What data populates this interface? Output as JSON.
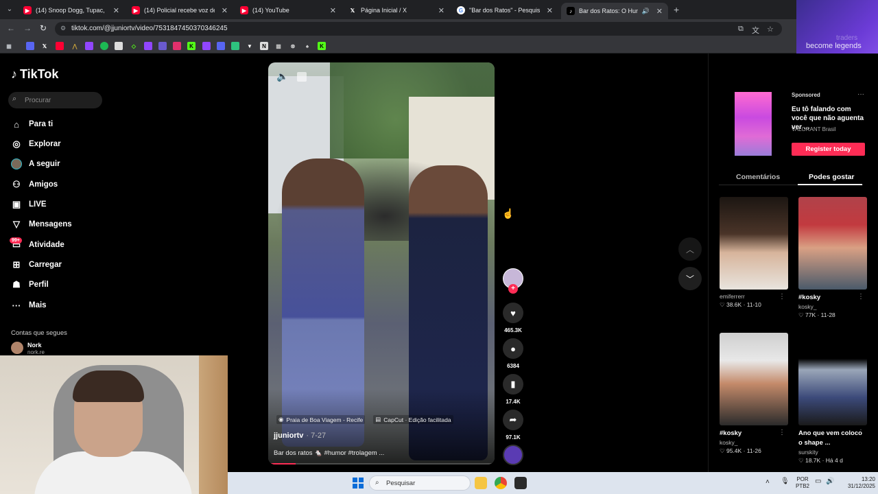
{
  "browser": {
    "tabs": [
      {
        "title": "(14) Snoop Dogg, Tupac, Nate ",
        "icon": "youtube-icon",
        "active": false
      },
      {
        "title": "(14) Policial recebe voz de prisã",
        "icon": "youtube-icon",
        "active": false
      },
      {
        "title": "(14) YouTube",
        "icon": "youtube-icon",
        "active": false
      },
      {
        "title": "Página Inicial / X",
        "icon": "x-icon",
        "active": false
      },
      {
        "title": "\"Bar dos Ratos\" - Pesquisa Goog",
        "icon": "google-icon",
        "active": false
      },
      {
        "title": "Bar dos Ratos: O Humor qu",
        "icon": "tiktok-icon",
        "active": true
      }
    ],
    "url": "tiktok.com/@jjuniortv/video/7531847450370346245"
  },
  "overlay_ad": {
    "line1": "traders",
    "line2": "become legends",
    "brand": "fomo"
  },
  "sidebar": {
    "logo": "TikTok",
    "search_placeholder": "Procurar",
    "items": [
      {
        "label": "Para ti",
        "icon": "home-icon"
      },
      {
        "label": "Explorar",
        "icon": "compass-icon"
      },
      {
        "label": "A seguir",
        "icon": "following-avatar-icon"
      },
      {
        "label": "Amigos",
        "icon": "friends-icon"
      },
      {
        "label": "LIVE",
        "icon": "live-icon"
      },
      {
        "label": "Mensagens",
        "icon": "messages-icon"
      },
      {
        "label": "Atividade",
        "icon": "activity-icon"
      },
      {
        "label": "Carregar",
        "icon": "upload-icon"
      },
      {
        "label": "Perfil",
        "icon": "profile-icon"
      },
      {
        "label": "Mais",
        "icon": "more-icon"
      }
    ],
    "activity_badge": "99+",
    "following_title": "Contas que segues",
    "following_user": {
      "name": "Nork",
      "handle": "nork.re"
    }
  },
  "video": {
    "location": "Praia de Boa Viagem - Recife",
    "app_tag": "CapCut · Edição facilitada",
    "author": "jjuniortv",
    "date": "· 7-27",
    "caption": "Bar dos ratos 🐁 #humor #trolagem ...",
    "progress_fraction": 0.12
  },
  "actions": {
    "likes": "465.3K",
    "comments": "6384",
    "saves": "17.4K",
    "shares": "97.1K"
  },
  "right_panel": {
    "ad": {
      "sponsored": "Sponsored",
      "title": "Eu tô falando com você que não aguenta ver ...",
      "brand": "VALORANT Brasil",
      "cta": "Register today"
    },
    "tabs": [
      "Comentários",
      "Podes gostar"
    ],
    "cards": [
      {
        "title": "",
        "user": "emiferrerr",
        "likes": "38.6K",
        "date": "11-10"
      },
      {
        "title": "#kosky",
        "user": "kosky_",
        "likes": "77K",
        "date": "11-28"
      },
      {
        "title": "#kosky",
        "user": "kosky_",
        "likes": "95.4K",
        "date": "11-26"
      },
      {
        "title": "Ano que vem coloco o shape ...",
        "user": "surskity",
        "likes": "18.7K",
        "date": "Há 4 d"
      }
    ]
  },
  "taskbar": {
    "search_label": "Pesquisar",
    "lang1": "POR",
    "lang2": "PTB2",
    "time": "13:20",
    "date": "31/12/2025"
  }
}
